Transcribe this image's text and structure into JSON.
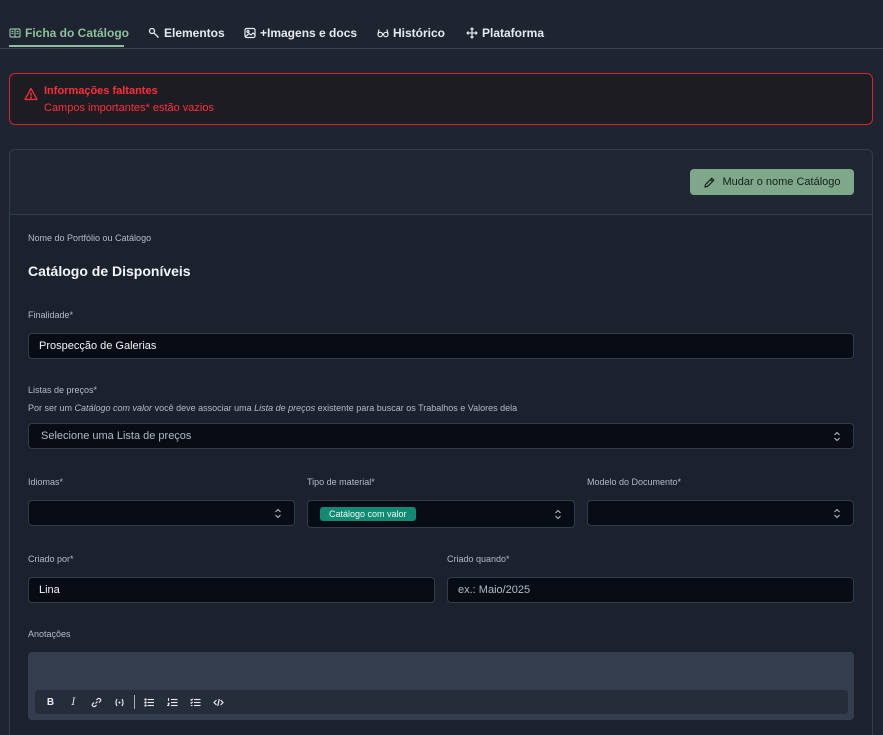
{
  "tabs": [
    {
      "label": "Ficha do Catálogo",
      "icon": "catalog-icon",
      "active": true
    },
    {
      "label": "Elementos",
      "icon": "tool-icon"
    },
    {
      "label": "+Imagens e docs",
      "icon": "image-icon"
    },
    {
      "label": "Histórico",
      "icon": "glasses-icon"
    },
    {
      "label": "Plataforma",
      "icon": "move-icon"
    }
  ],
  "alert": {
    "title": "Informações faltantes",
    "message": "Campos importantes* estão vazios",
    "color": "#ff2f3a"
  },
  "header": {
    "rename_button": "Mudar o nome Catálogo"
  },
  "form": {
    "name_label": "Nome do Portfólio ou Catálogo",
    "name_value": "Catálogo de Disponíveis",
    "purpose_label": "Finalidade*",
    "purpose_value": "Prospecção de Galerias",
    "pricelists_label": "Listas de preços*",
    "pricelists_hint_1": "Por ser um ",
    "pricelists_hint_em1": "Catálogo com valor",
    "pricelists_hint_2": " você deve associar uma ",
    "pricelists_hint_em2": "Lista de preços",
    "pricelists_hint_3": " existente para buscar os Trabalhos e Valores dela",
    "pricelists_placeholder": "Selecione uma Lista de preços",
    "languages_label": "Idiomas*",
    "languages_value": "",
    "material_label": "Tipo de material*",
    "material_value": "Catálogo com valor",
    "template_label": "Modelo do Documento*",
    "template_value": "",
    "created_by_label": "Criado por*",
    "created_by_value": "Lina",
    "created_when_label": "Criado quando*",
    "created_when_placeholder": "ex.: Maio/2025",
    "notes_label": "Anotações"
  },
  "editor_toolbar": [
    "bold",
    "italic",
    "link",
    "variable",
    "bullet-list",
    "ordered-list",
    "task-list",
    "code"
  ],
  "colors": {
    "accent": "#8fbf9e",
    "button": "#7fa88a",
    "badge": "#138a74",
    "error": "#d0272e"
  }
}
